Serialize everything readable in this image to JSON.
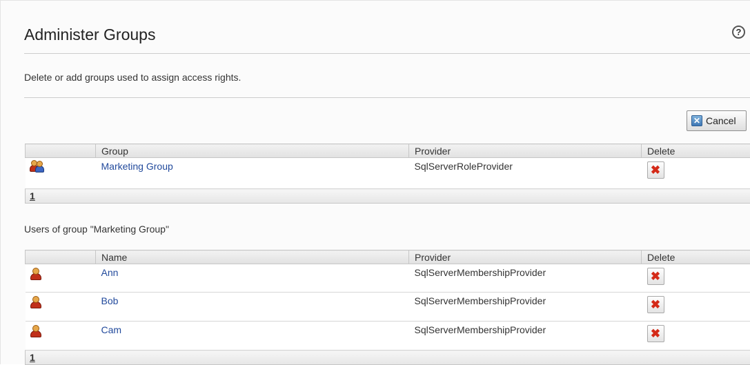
{
  "page": {
    "title": "Administer Groups",
    "help_glyph": "?",
    "description": "Delete or add groups used to assign access rights."
  },
  "toolbar": {
    "cancel_label": "Cancel",
    "cancel_icon": "cancel-icon"
  },
  "groups_table": {
    "headers": {
      "icon": "",
      "group": "Group",
      "provider": "Provider",
      "delete": "Delete"
    },
    "rows": [
      {
        "icon": "group-icon",
        "name": "Marketing Group",
        "provider": "SqlServerRoleProvider",
        "delete_glyph": "✖"
      }
    ],
    "pager": "1"
  },
  "users_section": {
    "caption": "Users of group \"Marketing Group\""
  },
  "users_table": {
    "headers": {
      "icon": "",
      "name": "Name",
      "provider": "Provider",
      "delete": "Delete"
    },
    "rows": [
      {
        "icon": "user-icon",
        "name": "Ann",
        "provider": "SqlServerMembershipProvider",
        "delete_glyph": "✖"
      },
      {
        "icon": "user-icon",
        "name": "Bob",
        "provider": "SqlServerMembershipProvider",
        "delete_glyph": "✖"
      },
      {
        "icon": "user-icon",
        "name": "Cam",
        "provider": "SqlServerMembershipProvider",
        "delete_glyph": "✖"
      }
    ],
    "pager": "1"
  },
  "colors": {
    "link": "#224a9c",
    "delete_icon": "#d42a18",
    "header_bg": "#e8e8e8"
  }
}
